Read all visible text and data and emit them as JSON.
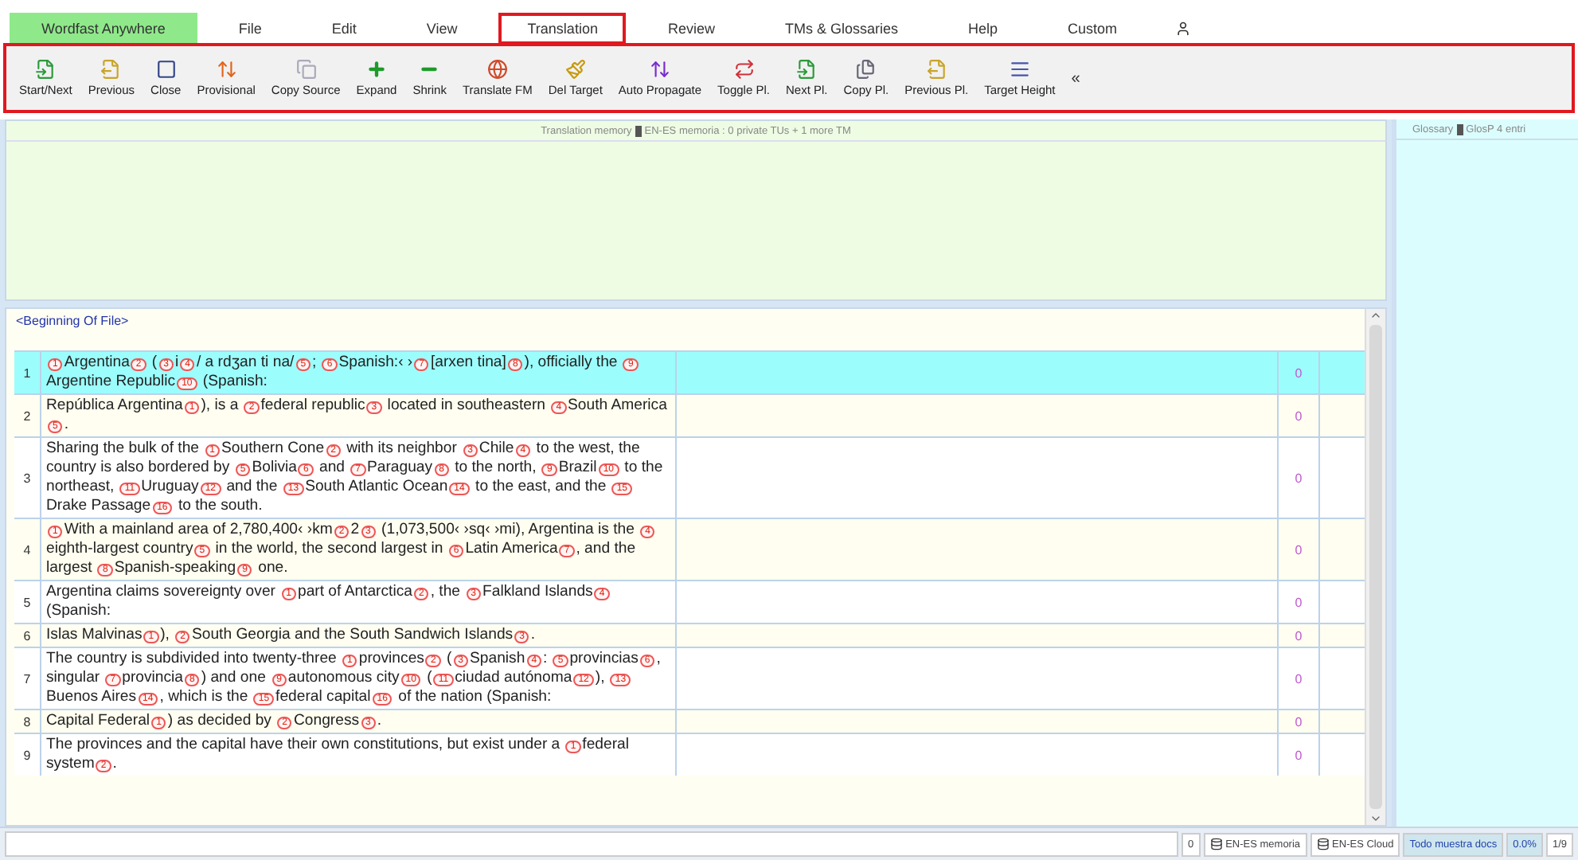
{
  "menu": [
    {
      "label": "Wordfast Anywhere",
      "kind": "brand",
      "highlighted": false
    },
    {
      "label": "File",
      "kind": "item",
      "highlighted": false
    },
    {
      "label": "Edit",
      "kind": "item",
      "highlighted": false
    },
    {
      "label": "View",
      "kind": "item",
      "highlighted": false
    },
    {
      "label": "Translation",
      "kind": "item",
      "highlighted": true
    },
    {
      "label": "Review",
      "kind": "item",
      "highlighted": false
    },
    {
      "label": "TMs & Glossaries",
      "kind": "item",
      "highlighted": false
    },
    {
      "label": "Help",
      "kind": "item",
      "highlighted": false
    },
    {
      "label": "Custom",
      "kind": "item",
      "highlighted": false
    },
    {
      "kind": "user"
    }
  ],
  "toolbar": {
    "highlighted": true,
    "buttons": [
      {
        "label": "Start/Next"
      },
      {
        "label": "Previous"
      },
      {
        "label": "Close"
      },
      {
        "label": "Provisional"
      },
      {
        "label": "Copy Source"
      },
      {
        "label": "Expand"
      },
      {
        "label": "Shrink"
      },
      {
        "label": "Translate FM"
      },
      {
        "label": "Del Target"
      },
      {
        "label": "Auto Propagate"
      },
      {
        "label": "Toggle Pl."
      },
      {
        "label": "Next Pl."
      },
      {
        "label": "Copy Pl."
      },
      {
        "label": "Previous Pl."
      },
      {
        "label": "Target Height"
      }
    ],
    "collapse": "«"
  },
  "tm_panel": {
    "header": "Translation memory",
    "header_rest": "EN-ES memoria : 0 private TUs + 1 more TM"
  },
  "glossary_panel": {
    "header": "Glossary",
    "header_rest": "GlosP 4 entri"
  },
  "beginning_label": "<Beginning Of File>",
  "segments": [
    {
      "number": "1",
      "selected": true,
      "match": "0",
      "source": [
        {
          "tag": "1"
        },
        {
          "text": "Argentina"
        },
        {
          "tag": "2"
        },
        {
          "text": " ("
        },
        {
          "tag": "3"
        },
        {
          "text": "i"
        },
        {
          "tag": "4"
        },
        {
          "text": "/ a rdʒan ti na/"
        },
        {
          "tag": "5"
        },
        {
          "text": "; "
        },
        {
          "tag": "6"
        },
        {
          "text": "Spanish:‹ ›"
        },
        {
          "tag": "7"
        },
        {
          "text": "[arxen tina]"
        },
        {
          "tag": "8"
        },
        {
          "text": "), officially the "
        },
        {
          "tag": "9"
        },
        {
          "text": "Argentine Republic"
        },
        {
          "tag": "10"
        },
        {
          "text": " (Spanish:"
        }
      ]
    },
    {
      "number": "2",
      "selected": false,
      "match": "0",
      "source": [
        {
          "text": "República Argentina"
        },
        {
          "tag": "1"
        },
        {
          "text": "), is a "
        },
        {
          "tag": "2"
        },
        {
          "text": "federal republic"
        },
        {
          "tag": "3"
        },
        {
          "text": " located in southeastern "
        },
        {
          "tag": "4"
        },
        {
          "text": "South America"
        },
        {
          "tag": "5"
        },
        {
          "text": "."
        }
      ]
    },
    {
      "number": "3",
      "selected": false,
      "match": "0",
      "source": [
        {
          "text": "Sharing the bulk of the "
        },
        {
          "tag": "1"
        },
        {
          "text": "Southern Cone"
        },
        {
          "tag": "2"
        },
        {
          "text": " with its neighbor "
        },
        {
          "tag": "3"
        },
        {
          "text": "Chile"
        },
        {
          "tag": "4"
        },
        {
          "text": " to the west, the country is also bordered by "
        },
        {
          "tag": "5"
        },
        {
          "text": "Bolivia"
        },
        {
          "tag": "6"
        },
        {
          "text": " and "
        },
        {
          "tag": "7"
        },
        {
          "text": "Paraguay"
        },
        {
          "tag": "8"
        },
        {
          "text": " to the north, "
        },
        {
          "tag": "9"
        },
        {
          "text": "Brazil"
        },
        {
          "tag": "10"
        },
        {
          "text": " to the northeast, "
        },
        {
          "tag": "11"
        },
        {
          "text": "Uruguay"
        },
        {
          "tag": "12"
        },
        {
          "text": " and the "
        },
        {
          "tag": "13"
        },
        {
          "text": "South Atlantic Ocean"
        },
        {
          "tag": "14"
        },
        {
          "text": " to the east, and the "
        },
        {
          "tag": "15"
        },
        {
          "text": "Drake Passage"
        },
        {
          "tag": "16"
        },
        {
          "text": " to the south."
        }
      ]
    },
    {
      "number": "4",
      "selected": false,
      "match": "0",
      "source": [
        {
          "tag": "1"
        },
        {
          "text": "With a mainland area of 2,780,400‹ ›km"
        },
        {
          "tag": "2"
        },
        {
          "text": "2"
        },
        {
          "tag": "3"
        },
        {
          "text": " (1,073,500‹ ›sq‹ ›mi), Argentina is the "
        },
        {
          "tag": "4"
        },
        {
          "text": "eighth-largest country"
        },
        {
          "tag": "5"
        },
        {
          "text": " in the world, the second largest in "
        },
        {
          "tag": "6"
        },
        {
          "text": "Latin America"
        },
        {
          "tag": "7"
        },
        {
          "text": ", and the largest "
        },
        {
          "tag": "8"
        },
        {
          "text": "Spanish-speaking"
        },
        {
          "tag": "9"
        },
        {
          "text": " one."
        }
      ]
    },
    {
      "number": "5",
      "selected": false,
      "match": "0",
      "source": [
        {
          "text": "Argentina claims sovereignty over "
        },
        {
          "tag": "1"
        },
        {
          "text": "part of Antarctica"
        },
        {
          "tag": "2"
        },
        {
          "text": ", the "
        },
        {
          "tag": "3"
        },
        {
          "text": "Falkland Islands"
        },
        {
          "tag": "4"
        },
        {
          "text": " (Spanish:"
        }
      ]
    },
    {
      "number": "6",
      "selected": false,
      "match": "0",
      "source": [
        {
          "text": "Islas Malvinas"
        },
        {
          "tag": "1"
        },
        {
          "text": "), "
        },
        {
          "tag": "2"
        },
        {
          "text": "South Georgia and the South Sandwich Islands"
        },
        {
          "tag": "3"
        },
        {
          "text": "."
        }
      ]
    },
    {
      "number": "7",
      "selected": false,
      "match": "0",
      "source": [
        {
          "text": "The country is subdivided into twenty-three "
        },
        {
          "tag": "1"
        },
        {
          "text": "provinces"
        },
        {
          "tag": "2"
        },
        {
          "text": " ("
        },
        {
          "tag": "3"
        },
        {
          "text": "Spanish"
        },
        {
          "tag": "4"
        },
        {
          "text": ": "
        },
        {
          "tag": "5"
        },
        {
          "text": "provincias"
        },
        {
          "tag": "6"
        },
        {
          "text": ", singular "
        },
        {
          "tag": "7"
        },
        {
          "text": "provincia"
        },
        {
          "tag": "8"
        },
        {
          "text": ") and one "
        },
        {
          "tag": "9"
        },
        {
          "text": "autonomous city"
        },
        {
          "tag": "10"
        },
        {
          "text": " ("
        },
        {
          "tag": "11"
        },
        {
          "text": "ciudad autónoma"
        },
        {
          "tag": "12"
        },
        {
          "text": "), "
        },
        {
          "tag": "13"
        },
        {
          "text": "Buenos Aires"
        },
        {
          "tag": "14"
        },
        {
          "text": ", which is the "
        },
        {
          "tag": "15"
        },
        {
          "text": "federal capital"
        },
        {
          "tag": "16"
        },
        {
          "text": " of the nation (Spanish:"
        }
      ]
    },
    {
      "number": "8",
      "selected": false,
      "match": "0",
      "source": [
        {
          "text": "Capital Federal"
        },
        {
          "tag": "1"
        },
        {
          "text": ") as decided by "
        },
        {
          "tag": "2"
        },
        {
          "text": "Congress"
        },
        {
          "tag": "3"
        },
        {
          "text": "."
        }
      ]
    },
    {
      "number": "9",
      "selected": false,
      "match": "0",
      "source": [
        {
          "text": "The provinces and the capital have their own constitutions, but exist under a "
        },
        {
          "tag": "1"
        },
        {
          "text": "federal system"
        },
        {
          "tag": "2"
        },
        {
          "text": "."
        }
      ]
    }
  ],
  "status_bar": {
    "items": [
      {
        "text": "0",
        "kind": "plain"
      },
      {
        "text": "EN-ES memoria",
        "kind": "db"
      },
      {
        "text": "EN-ES Cloud",
        "kind": "db"
      },
      {
        "text": "Todo muestra docs",
        "kind": "info"
      },
      {
        "text": "0.0%",
        "kind": "info"
      },
      {
        "text": "1/9",
        "kind": "plain"
      }
    ]
  }
}
